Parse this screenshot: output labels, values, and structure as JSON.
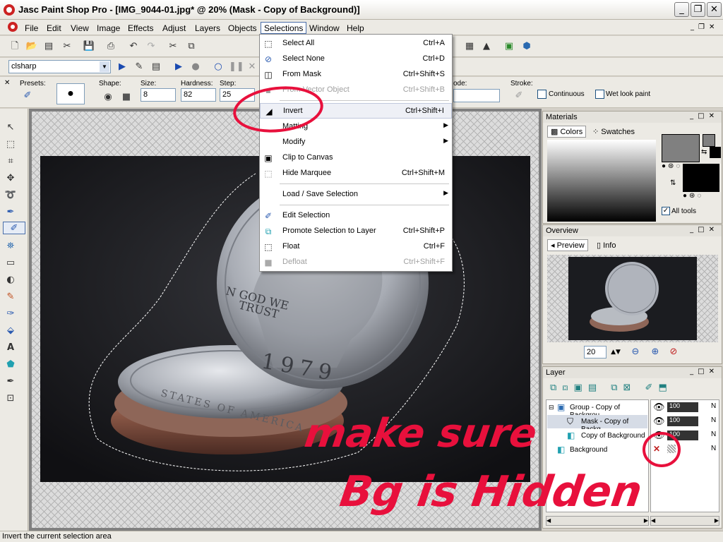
{
  "window": {
    "title": "Jasc Paint Shop Pro - [IMG_9044-01.jpg* @  20% (Mask - Copy of Background)]"
  },
  "menubar": [
    "File",
    "Edit",
    "View",
    "Image",
    "Effects",
    "Adjust",
    "Layers",
    "Objects",
    "Selections",
    "Window",
    "Help"
  ],
  "script": {
    "name": "clsharp"
  },
  "tool_options": {
    "presets_label": "Presets:",
    "shape_label": "Shape:",
    "size_label": "Size:",
    "size_value": "8",
    "hardness_label": "Hardness:",
    "hardness_value": "82",
    "step_label": "Step:",
    "step_value": "25",
    "mode_label": "ode:",
    "stroke_label": "Stroke:",
    "continuous_label": "Continuous",
    "wet_label": "Wet look paint"
  },
  "selections_menu": [
    {
      "label": "Select All",
      "shortcut": "Ctrl+A",
      "icon": "select-all-icon",
      "disabled": false
    },
    {
      "label": "Select None",
      "shortcut": "Ctrl+D",
      "icon": "select-none-icon",
      "disabled": false
    },
    {
      "label": "From Mask",
      "shortcut": "Ctrl+Shift+S",
      "icon": "from-mask-icon",
      "disabled": false
    },
    {
      "label": "From Vector Object",
      "shortcut": "Ctrl+Shift+B",
      "icon": "vector-icon",
      "disabled": true
    },
    {
      "label": "Invert",
      "shortcut": "Ctrl+Shift+I",
      "icon": "invert-icon",
      "disabled": false
    },
    {
      "label": "Matting",
      "shortcut": "",
      "icon": "",
      "disabled": false,
      "submenu": true
    },
    {
      "label": "Modify",
      "shortcut": "",
      "icon": "",
      "disabled": false,
      "submenu": true
    },
    {
      "label": "Clip to Canvas",
      "shortcut": "",
      "icon": "clip-icon",
      "disabled": false
    },
    {
      "label": "Hide Marquee",
      "shortcut": "Ctrl+Shift+M",
      "icon": "marquee-icon",
      "disabled": false
    },
    {
      "label": "Load / Save Selection",
      "shortcut": "",
      "icon": "",
      "disabled": false,
      "submenu": true
    },
    {
      "label": "Edit Selection",
      "shortcut": "",
      "icon": "edit-selection-icon",
      "disabled": false
    },
    {
      "label": "Promote Selection to Layer",
      "shortcut": "Ctrl+Shift+P",
      "icon": "promote-icon",
      "disabled": false
    },
    {
      "label": "Float",
      "shortcut": "Ctrl+F",
      "icon": "float-icon",
      "disabled": false
    },
    {
      "label": "Defloat",
      "shortcut": "Ctrl+Shift+F",
      "icon": "defloat-icon",
      "disabled": true
    }
  ],
  "materials": {
    "title": "Materials",
    "tab_colors": "Colors",
    "tab_swatches": "Swatches",
    "all_tools": "All tools"
  },
  "overview": {
    "title": "Overview",
    "tab_preview": "Preview",
    "tab_info": "Info",
    "zoom": "20"
  },
  "layers": {
    "title": "Layer",
    "rows": [
      {
        "name": "Group - Copy of Backgrou",
        "opacity": "100",
        "mode": "N"
      },
      {
        "name": "Mask - Copy of Backg",
        "opacity": "100",
        "mode": "N"
      },
      {
        "name": "Copy of Background",
        "opacity": "100",
        "mode": "N"
      },
      {
        "name": "Background",
        "opacity": "",
        "mode": "N"
      }
    ]
  },
  "coin": {
    "line1": "N GOD WE",
    "line2": "TRUST",
    "year": "1979",
    "rim": "STATES OF AMERICA"
  },
  "annotation": {
    "line1": "make sure",
    "line2": "Bg is Hidden"
  },
  "status": "Invert the current selection area",
  "colors": {
    "annotation": "#e8103c",
    "menu_highlight": "#eef0f6",
    "canvas_bg": "#1d1d20",
    "coin": "#b8bcc2"
  }
}
